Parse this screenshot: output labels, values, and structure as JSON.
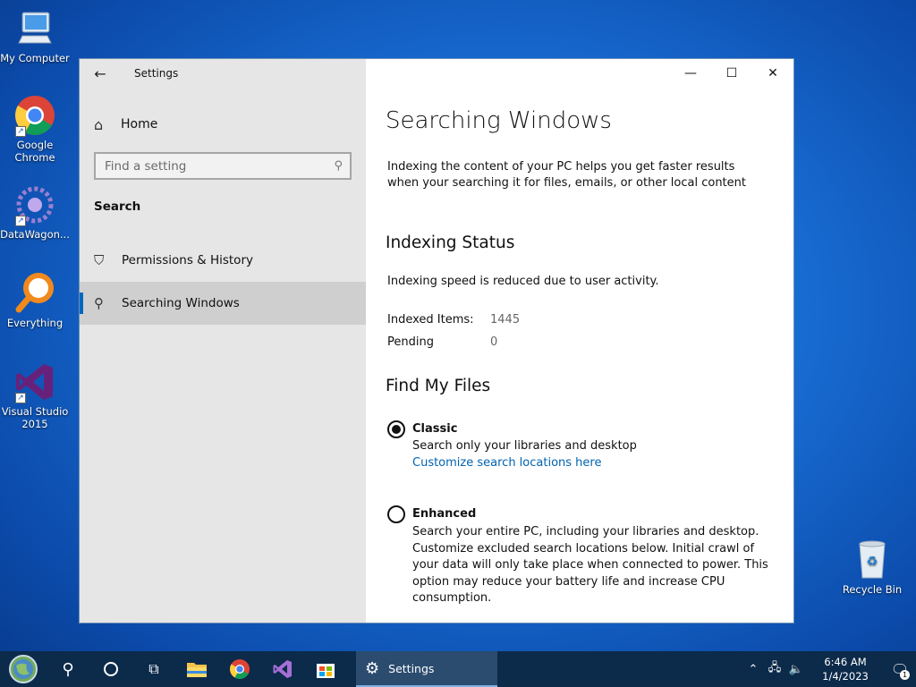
{
  "desktop": {
    "icons": [
      {
        "label": "My Computer"
      },
      {
        "label": "Google Chrome"
      },
      {
        "label": "DataWagon..."
      },
      {
        "label": "Everything"
      },
      {
        "label": "Visual Studio 2015"
      },
      {
        "label": "Recycle Bin"
      }
    ]
  },
  "window": {
    "title": "Settings",
    "controls": {
      "minimize": "—",
      "maximize": "☐",
      "close": "✕"
    }
  },
  "sidebar": {
    "home_label": "Home",
    "search_placeholder": "Find a setting",
    "section_label": "Search",
    "items": [
      {
        "label": "Permissions & History",
        "active": false
      },
      {
        "label": "Searching Windows",
        "active": true
      }
    ]
  },
  "content": {
    "title": "Searching Windows",
    "intro": "Indexing the content of your PC helps you get faster results when your searching it for files, emails, or other local content",
    "indexing": {
      "heading": "Indexing Status",
      "status": "Indexing speed is reduced due to user activity.",
      "indexed_label": "Indexed Items:",
      "indexed_value": "1445",
      "pending_label": "Pending",
      "pending_value": "0"
    },
    "find_files": {
      "heading": "Find My Files",
      "classic": {
        "label": "Classic",
        "description": "Search only your libraries and desktop",
        "link": "Customize search locations here",
        "checked": true
      },
      "enhanced": {
        "label": "Enhanced",
        "description": "Search your entire PC, including your libraries and desktop. Customize excluded search locations below. Initial crawl of your data will only take place when connected to power. This option may reduce your battery life and increase CPU consumption.",
        "checked": false
      }
    }
  },
  "taskbar": {
    "active_task": "Settings",
    "clock_time": "6:46 AM",
    "clock_date": "1/4/2023",
    "notification_count": "1"
  },
  "colors": {
    "accent": "#0067c0",
    "link": "#0063b1",
    "taskbar": "#0c2a4a"
  }
}
